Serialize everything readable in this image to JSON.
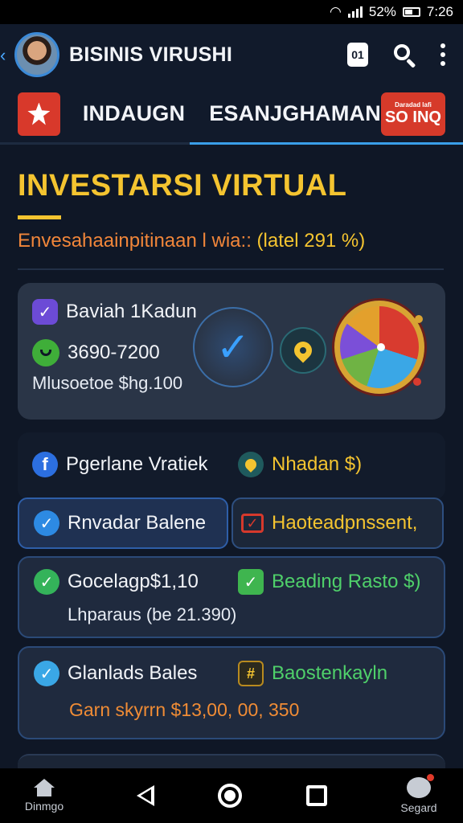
{
  "statusbar": {
    "battery": "52%",
    "time": "7:26"
  },
  "appbar": {
    "title": "BISINIS VIRUSHI",
    "badge": "01"
  },
  "tabs": {
    "first": "INDAUGN",
    "second": "ESANJGHAMAN",
    "sale_small": "Daradad lafi",
    "sale_big": "SO INQ"
  },
  "page": {
    "title": "INVESTARSI VIRTUAL",
    "subtitle_main": "Envesahaainpitinaan l wia::",
    "subtitle_highlight": "(latel 291 %)"
  },
  "top_card": {
    "line1": "Baviah 1Kadun",
    "line2": "3690-7200",
    "line3": "Mlusoetoe $hg.100"
  },
  "section2": {
    "left": "Pgerlane Vratiek",
    "right": "Nhadan $)"
  },
  "pills": {
    "left": "Rnvadar Balene",
    "right": "Haoteadpnssent,"
  },
  "card1": {
    "left": "Gocelagp$1,10",
    "right": "Beading Rasto $)",
    "sub": "Lhparaus (be 21.390)"
  },
  "card2": {
    "left": "Glanlads Bales",
    "right": "Baostenkayln",
    "sub": "Garn skyrrn $13,00, 00, 350"
  },
  "nav": {
    "left_label": "Dinmgo",
    "right_label": "Segard"
  },
  "colors": {
    "accent_yellow": "#f4c430",
    "accent_orange": "#f08c35",
    "accent_green": "#4fd06a",
    "accent_blue": "#3a9ee8",
    "badge_red": "#d63a2a"
  }
}
